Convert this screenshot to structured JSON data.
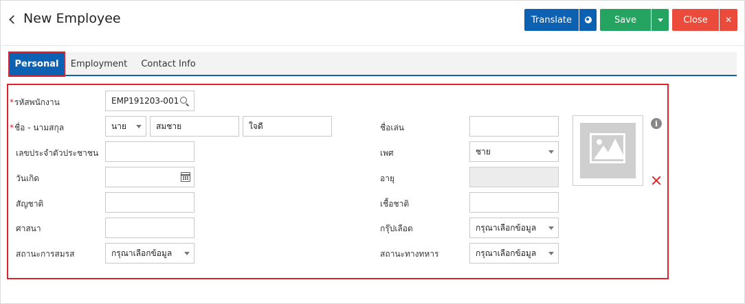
{
  "header": {
    "title": "New Employee",
    "translate_label": "Translate",
    "save_label": "Save",
    "close_label": "Close"
  },
  "tabs": [
    {
      "label": "Personal",
      "active": true
    },
    {
      "label": "Employment",
      "active": false
    },
    {
      "label": "Contact Info",
      "active": false
    }
  ],
  "form": {
    "employee_code": {
      "label": "รหัสพนักงาน",
      "required": true,
      "value": "EMP191203-001"
    },
    "name": {
      "label": "ชื่อ - นามสกุล",
      "required": true,
      "title": "นาย",
      "first_name": "สมชาย",
      "last_name": "ใจดี"
    },
    "national_id": {
      "label": "เลขประจำตัวประชาชน",
      "value": ""
    },
    "birth_date": {
      "label": "วันเกิด",
      "value": ""
    },
    "nationality": {
      "label": "สัญชาติ",
      "value": ""
    },
    "religion": {
      "label": "ศาสนา",
      "value": ""
    },
    "marital_status": {
      "label": "สถานะการสมรส",
      "value": "กรุณาเลือกข้อมูล"
    },
    "nickname": {
      "label": "ชื่อเล่น",
      "value": ""
    },
    "gender": {
      "label": "เพศ",
      "value": "ชาย"
    },
    "age": {
      "label": "อายุ",
      "value": ""
    },
    "ethnicity": {
      "label": "เชื้อชาติ",
      "value": ""
    },
    "blood_group": {
      "label": "กรุ๊ปเลือด",
      "value": "กรุณาเลือกข้อมูล"
    },
    "military_status": {
      "label": "สถานะทางทหาร",
      "value": "กรุณาเลือกข้อมูล"
    }
  },
  "colors": {
    "primary": "#0d61b3",
    "success": "#25a461",
    "danger": "#ea4b3b",
    "highlight": "#e0232b"
  }
}
